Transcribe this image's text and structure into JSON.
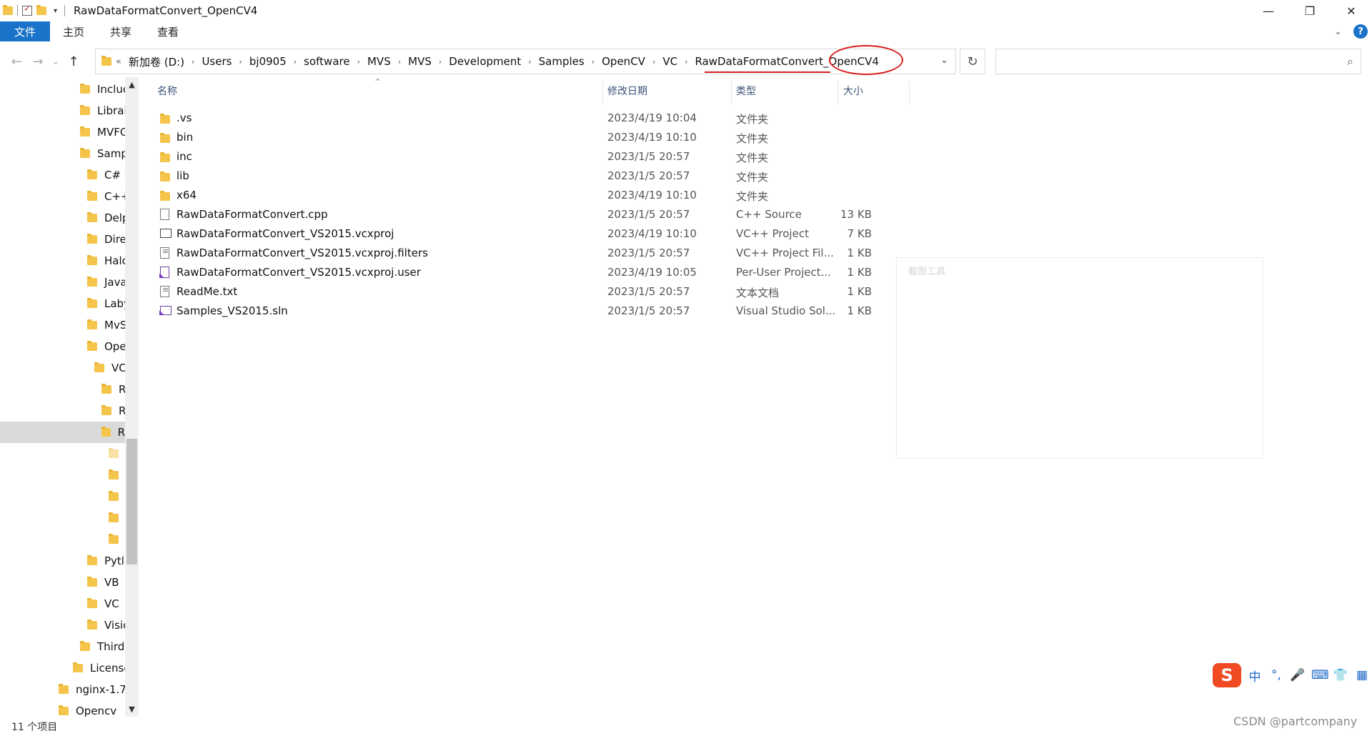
{
  "window": {
    "title": "RawDataFormatConvert_OpenCV4",
    "controls": {
      "minimize": "—",
      "maximize": "❐",
      "close": "✕"
    }
  },
  "ribbon": {
    "tabs": [
      "文件",
      "主页",
      "共享",
      "查看"
    ],
    "help": "?"
  },
  "nav": {
    "back": "←",
    "forward": "→",
    "recent": "⌄",
    "up": "↑",
    "overflow": "«",
    "refresh": "↻",
    "search_icon": "⌕"
  },
  "address": {
    "crumbs": [
      "新加卷 (D:)",
      "Users",
      "bj0905",
      "software",
      "MVS",
      "MVS",
      "Development",
      "Samples",
      "OpenCV",
      "VC",
      "RawDataFormatConvert_OpenCV4"
    ],
    "separator": "›",
    "dropdown": "⌄"
  },
  "tree": {
    "items": [
      {
        "label": "Incluc"
      },
      {
        "label": "Librai"
      },
      {
        "label": "MVFG"
      },
      {
        "label": "Samp"
      },
      {
        "label": "C#"
      },
      {
        "label": "C++"
      },
      {
        "label": "Delp"
      },
      {
        "label": "Dire"
      },
      {
        "label": "Halc"
      },
      {
        "label": "Java"
      },
      {
        "label": "Laby"
      },
      {
        "label": "MvS"
      },
      {
        "label": "Ope"
      },
      {
        "label": "VC"
      },
      {
        "label": "R"
      },
      {
        "label": "R"
      },
      {
        "label": "R"
      },
      {
        "label": ""
      },
      {
        "label": ""
      },
      {
        "label": ""
      },
      {
        "label": ""
      },
      {
        "label": ""
      },
      {
        "label": "Pytl"
      },
      {
        "label": "VB"
      },
      {
        "label": "VC"
      },
      {
        "label": "Visic"
      },
      {
        "label": "Third"
      },
      {
        "label": "License"
      },
      {
        "label": "nginx-1.7"
      },
      {
        "label": "Opencv"
      }
    ],
    "scroll_up": "▲",
    "scroll_down": "▼"
  },
  "columns": {
    "name": "名称",
    "date": "修改日期",
    "type": "类型",
    "size": "大小",
    "sort_indicator": "^"
  },
  "files": [
    {
      "name": ".vs",
      "date": "2023/4/19 10:04",
      "type": "文件夹",
      "size": "",
      "icon": "folder-icon"
    },
    {
      "name": "bin",
      "date": "2023/4/19 10:10",
      "type": "文件夹",
      "size": "",
      "icon": "folder-icon"
    },
    {
      "name": "inc",
      "date": "2023/1/5 20:57",
      "type": "文件夹",
      "size": "",
      "icon": "folder-icon"
    },
    {
      "name": "lib",
      "date": "2023/1/5 20:57",
      "type": "文件夹",
      "size": "",
      "icon": "folder-icon"
    },
    {
      "name": "x64",
      "date": "2023/4/19 10:10",
      "type": "文件夹",
      "size": "",
      "icon": "folder-icon"
    },
    {
      "name": "RawDataFormatConvert.cpp",
      "date": "2023/1/5 20:57",
      "type": "C++ Source",
      "size": "13 KB",
      "icon": "cpp-file-icon"
    },
    {
      "name": "RawDataFormatConvert_VS2015.vcxproj",
      "date": "2023/4/19 10:10",
      "type": "VC++ Project",
      "size": "7 KB",
      "icon": "project-file-icon"
    },
    {
      "name": "RawDataFormatConvert_VS2015.vcxproj.filters",
      "date": "2023/1/5 20:57",
      "type": "VC++ Project Fil...",
      "size": "1 KB",
      "icon": "filters-file-icon"
    },
    {
      "name": "RawDataFormatConvert_VS2015.vcxproj.user",
      "date": "2023/4/19 10:05",
      "type": "Per-User Project...",
      "size": "1 KB",
      "icon": "vs-user-file-icon"
    },
    {
      "name": "ReadMe.txt",
      "date": "2023/1/5 20:57",
      "type": "文本文档",
      "size": "1 KB",
      "icon": "text-file-icon"
    },
    {
      "name": "Samples_VS2015.sln",
      "date": "2023/1/5 20:57",
      "type": "Visual Studio Sol...",
      "size": "1 KB",
      "icon": "solution-file-icon"
    }
  ],
  "float_panel": {
    "label": "截图工具"
  },
  "status": {
    "item_count": "11 个项目"
  },
  "ime": {
    "logo": "S",
    "items": [
      "中",
      "°,",
      "🎤",
      "⌨",
      "👕",
      "▦"
    ]
  },
  "watermark": "CSDN @partcompany",
  "colors": {
    "accent": "#1a73c9",
    "annotation": "#d81e1e",
    "folder": "#f4c54a"
  }
}
